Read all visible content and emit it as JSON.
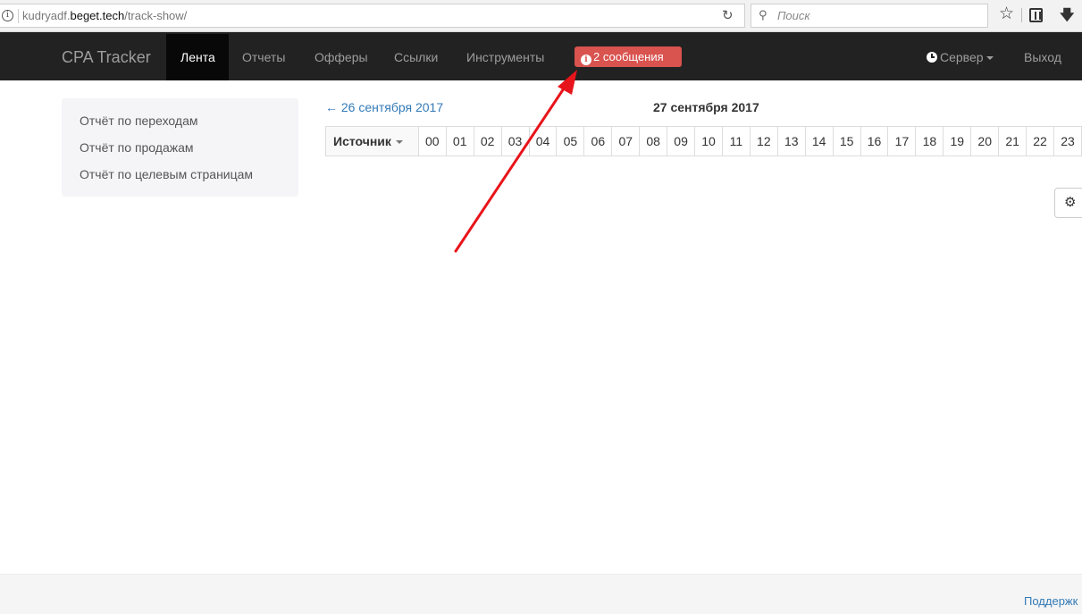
{
  "browser": {
    "url_prefix": "kudryadf.",
    "url_domain": "beget.tech",
    "url_path": "/track-show/",
    "search_placeholder": "Поиск"
  },
  "navbar": {
    "brand": "CPA Tracker",
    "items": [
      "Лента",
      "Отчеты",
      "Офферы",
      "Ссылки",
      "Инструменты"
    ],
    "active_index": 0,
    "messages_label": "2 сообщения",
    "server_label": "Сервер",
    "logout_label": "Выход"
  },
  "sidebar": {
    "links": [
      "Отчёт по переходам",
      "Отчёт по продажам",
      "Отчёт по целевым страницам"
    ]
  },
  "date_nav": {
    "prev_label": "← 26 сентября 2017",
    "current_label": "27 сентября 2017"
  },
  "hours_table": {
    "source_header": "Источник",
    "hours": [
      "00",
      "01",
      "02",
      "03",
      "04",
      "05",
      "06",
      "07",
      "08",
      "09",
      "10",
      "11",
      "12",
      "13",
      "14",
      "15",
      "16",
      "17",
      "18",
      "19",
      "20",
      "21",
      "22",
      "23"
    ]
  },
  "footer": {
    "support_label": "Поддержк"
  },
  "colors": {
    "navbar_bg": "#222222",
    "badge_bg": "#d9534f",
    "link": "#337ab7",
    "annotation_arrow": "#e8141b"
  }
}
